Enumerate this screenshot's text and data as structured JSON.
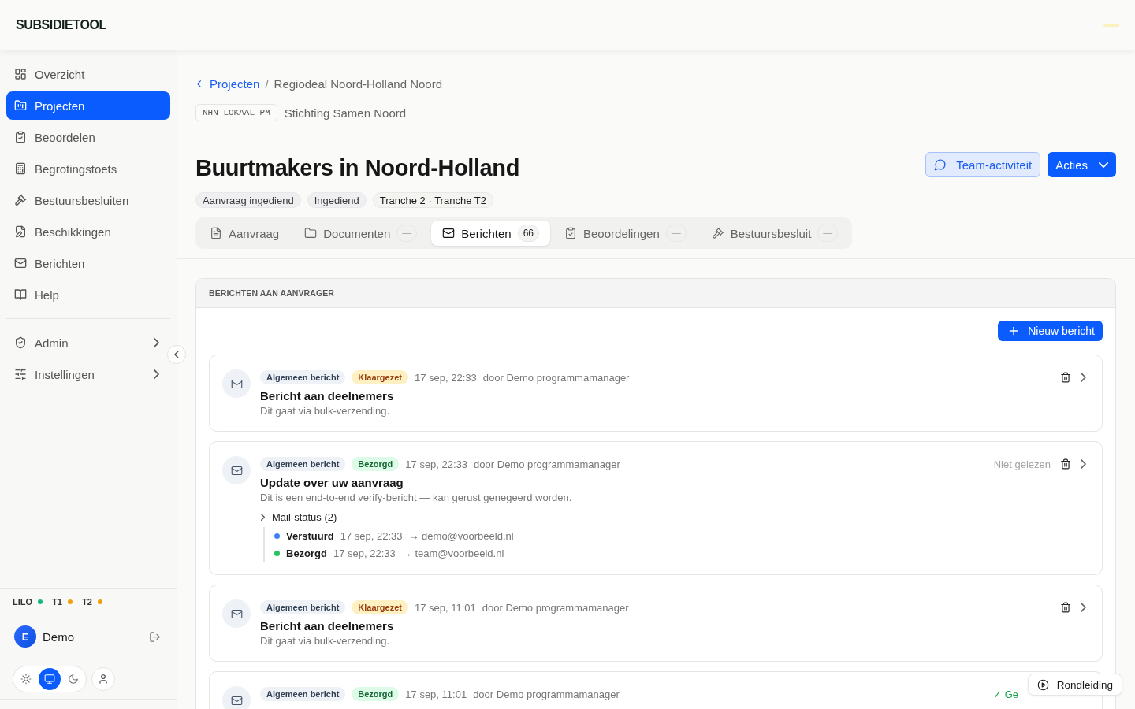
{
  "header": {
    "logo": "SUBSIDIETOOL"
  },
  "sidebar": {
    "items": [
      {
        "label": "Overzicht",
        "selected": false
      },
      {
        "label": "Projecten",
        "selected": true
      },
      {
        "label": "Beoordelen",
        "selected": false
      },
      {
        "label": "Begrotingstoets",
        "selected": false
      },
      {
        "label": "Bestuursbesluiten",
        "selected": false
      },
      {
        "label": "Beschikkingen",
        "selected": false
      },
      {
        "label": "Berichten",
        "selected": false
      },
      {
        "label": "Help",
        "selected": false
      }
    ],
    "groups": [
      {
        "label": "Admin",
        "expanded": false
      },
      {
        "label": "Instellingen",
        "expanded": false
      }
    ],
    "environments": [
      {
        "label": "LILO",
        "color": "#10b981"
      },
      {
        "label": "T1",
        "color": "#f59e0b"
      },
      {
        "label": "T2",
        "color": "#f59e0b"
      }
    ],
    "user": {
      "initial": "E",
      "name": "Demo"
    },
    "theme_options": [
      {
        "selected": false
      },
      {
        "selected": true
      },
      {
        "selected": false
      }
    ]
  },
  "breadcrumb": {
    "back": "Projecten",
    "separator": "/",
    "current": "Regiodeal Noord-Holland Noord"
  },
  "project": {
    "code": "NHN-LOKAAL-PM",
    "organisation": "Stichting Samen Noord",
    "title": "Buurtmakers in Noord-Holland",
    "tags": [
      {
        "label": "Aanvraag ingediend",
        "kind": "status"
      },
      {
        "label": "Ingediend",
        "kind": "status"
      },
      {
        "label": "Tranche 2 · Tranche T2",
        "kind": "tranche"
      }
    ],
    "buttons": {
      "team": "Team-activiteit",
      "actions": "Acties"
    }
  },
  "tabs": [
    {
      "label": "Aanvraag",
      "selected": false
    },
    {
      "label": "Documenten",
      "count": "—",
      "selected": false
    },
    {
      "label": "Berichten",
      "count": "66",
      "selected": true
    },
    {
      "label": "Beoordelingen",
      "count": "—",
      "selected": false
    },
    {
      "label": "Bestuursbesluit",
      "count": "—",
      "selected": false
    }
  ],
  "messages_panel": {
    "title": "BERICHTEN AAN AANVRAGER",
    "new_button": "Nieuw bericht",
    "messages": [
      {
        "category": "Algemeen bericht",
        "status": {
          "label": "Klaargezet",
          "kind": "pending"
        },
        "date": "17 sep, 22:33",
        "author": "door Demo programmamanager",
        "title": "Bericht aan deelnemers",
        "body": "Dit gaat via bulk-verzending."
      },
      {
        "category": "Algemeen bericht",
        "status": {
          "label": "Bezorgd",
          "kind": "delivered"
        },
        "date": "17 sep, 22:33",
        "author": "door Demo programmamanager",
        "title": "Update over uw aanvraag",
        "body": "Dit is een end-to-end verify-bericht — kan gerust genegeerd worden.",
        "read": {
          "label": "Niet gelezen",
          "kind": "unread"
        },
        "mail_status": {
          "label": "Mail-status (2)",
          "entries": [
            {
              "status": "Verstuurd",
              "color": "#3b82f6",
              "date": "17 sep, 22:33",
              "recipient": "→ demo@voorbeeld.nl"
            },
            {
              "status": "Bezorgd",
              "color": "#22c55e",
              "date": "17 sep, 22:33",
              "recipient": "→ team@voorbeeld.nl"
            }
          ]
        }
      },
      {
        "category": "Algemeen bericht",
        "status": {
          "label": "Klaargezet",
          "kind": "pending"
        },
        "date": "17 sep, 11:01",
        "author": "door Demo programmamanager",
        "title": "Bericht aan deelnemers",
        "body": "Dit gaat via bulk-verzending."
      },
      {
        "category": "Algemeen bericht",
        "status": {
          "label": "Bezorgd",
          "kind": "delivered"
        },
        "date": "17 sep, 11:01",
        "author": "door Demo programmamanager",
        "read": {
          "label": "✓ Ge",
          "kind": "read"
        }
      }
    ]
  },
  "tour_button": "Rondleiding"
}
